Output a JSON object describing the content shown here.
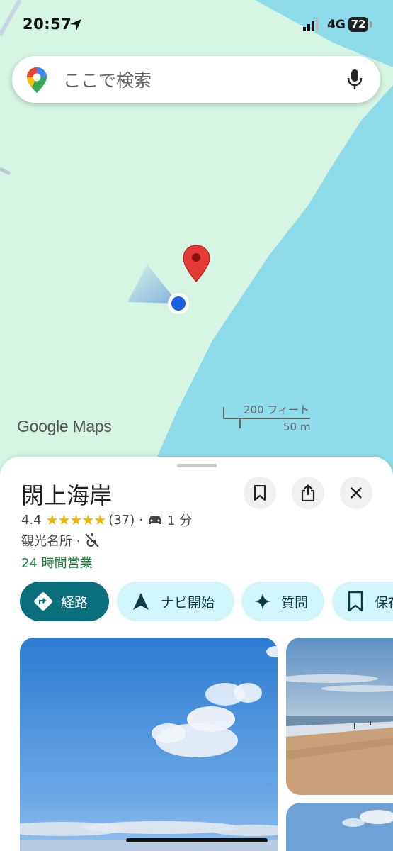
{
  "status_bar": {
    "time": "20:57",
    "network": "4G",
    "battery": "72"
  },
  "search": {
    "placeholder": "ここで検索"
  },
  "map": {
    "watermark": "Google Maps",
    "scale_ft": "200 フィート",
    "scale_m": "50 m"
  },
  "place": {
    "title": "閖上海岸",
    "rating": "4.4",
    "stars": "★★★★★",
    "reviews": "(37)",
    "dot": "·",
    "drive_time": "1 分",
    "category": "観光名所 ·",
    "hours": "24 時間営業"
  },
  "actions": [
    {
      "label": "経路",
      "icon": "directions-icon"
    },
    {
      "label": "ナビ開始",
      "icon": "navigation-arrow-icon"
    },
    {
      "label": "質問",
      "icon": "sparkle-icon"
    },
    {
      "label": "保存",
      "icon": "bookmark-icon"
    }
  ],
  "colors": {
    "land": "#d5f4e2",
    "water": "#8edbea",
    "primary_chip": "#0b6e7c",
    "secondary_chip": "#d2f4fb",
    "open_green": "#188038",
    "pin_red": "#e53935",
    "location_blue": "#1a5fe0"
  }
}
